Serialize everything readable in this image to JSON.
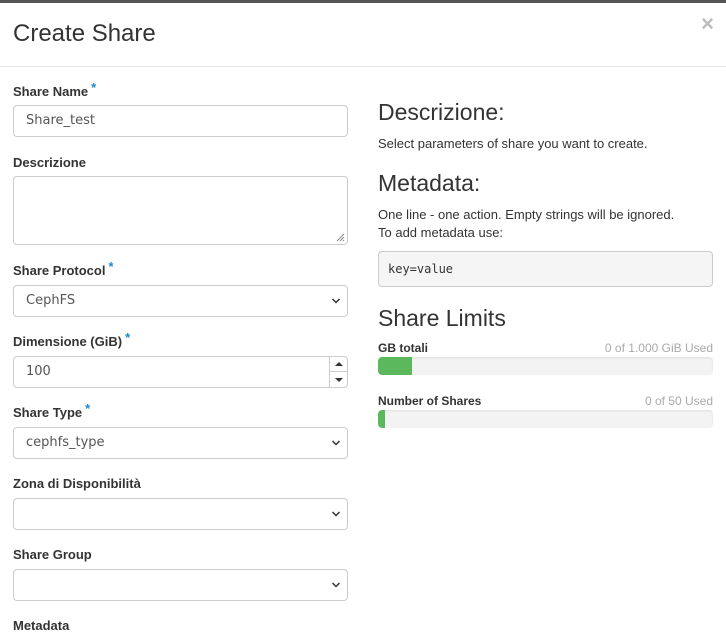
{
  "modal": {
    "title": "Create Share",
    "close_glyph": "×"
  },
  "form": {
    "share_name": {
      "label": "Share Name",
      "required": "*",
      "value": "Share_test"
    },
    "description": {
      "label": "Descrizione",
      "value": ""
    },
    "share_protocol": {
      "label": "Share Protocol",
      "required": "*",
      "value": "CephFS"
    },
    "size": {
      "label": "Dimensione (GiB)",
      "required": "*",
      "value": "100"
    },
    "share_type": {
      "label": "Share Type",
      "required": "*",
      "value": "cephfs_type"
    },
    "availability_zone": {
      "label": "Zona di Disponibilità",
      "value": ""
    },
    "share_group": {
      "label": "Share Group",
      "value": ""
    },
    "metadata": {
      "label": "Metadata"
    }
  },
  "help": {
    "description_heading": "Descrizione:",
    "description_text": "Select parameters of share you want to create.",
    "metadata_heading": "Metadata:",
    "metadata_line1": "One line - one action. Empty strings will be ignored.",
    "metadata_line2": "To add metadata use:",
    "metadata_example": "key=value"
  },
  "limits": {
    "heading": "Share Limits",
    "gb": {
      "label": "GB totali",
      "used_text": "0 of 1.000 GiB Used",
      "fill_fraction": 0.1
    },
    "shares": {
      "label": "Number of Shares",
      "used_text": "0 of 50 Used",
      "fill_fraction": 0.02
    }
  },
  "colors": {
    "required_marker": "#1e88d0",
    "progress_fill": "#5cb85c"
  },
  "icons": {
    "close": "close-icon",
    "select": "chevron-down-icon",
    "spin_up": "chevron-up-icon",
    "spin_down": "chevron-down-icon",
    "resize": "resize-grip-icon"
  }
}
